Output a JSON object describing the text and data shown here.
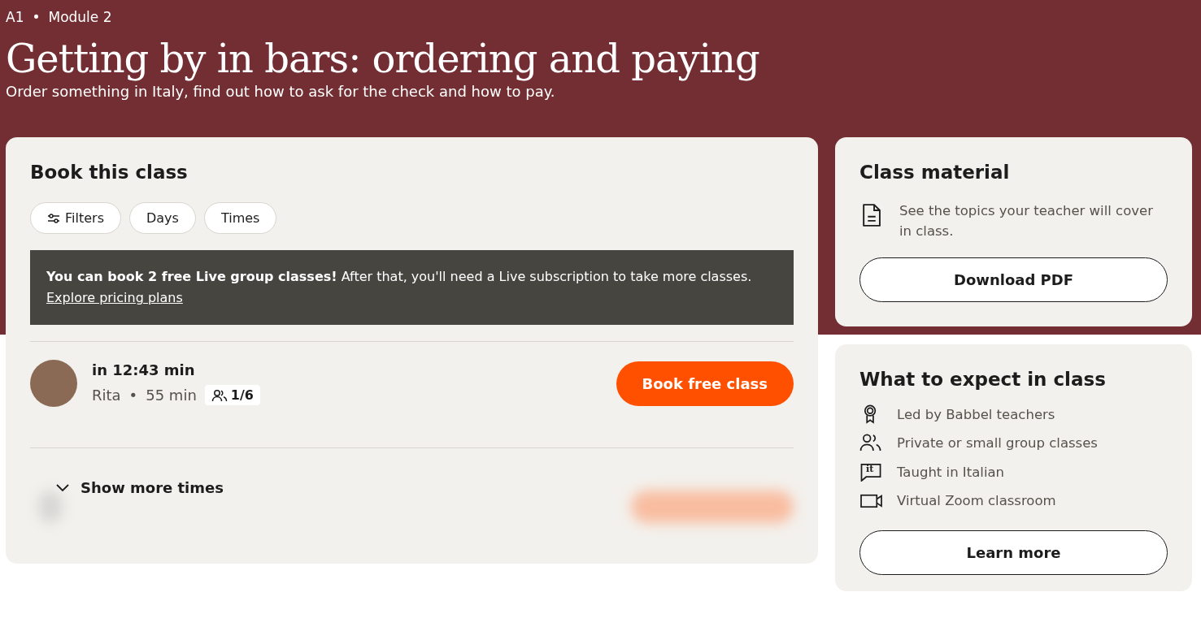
{
  "breadcrumb": {
    "level": "A1",
    "separator": "•",
    "module": "Module 2"
  },
  "title": "Getting by in bars: ordering and paying",
  "subtitle": "Order something in Italy, find out how to ask for the check and how to pay.",
  "booking": {
    "heading": "Book this class",
    "filters": [
      {
        "label": "Filters",
        "kind": "filters"
      },
      {
        "label": "Days",
        "kind": "plain"
      },
      {
        "label": "Times",
        "kind": "plain"
      }
    ],
    "notice": {
      "text": "**You can book 2 free Live group classes!** After that, you'll need a Live subscription to take more classes.",
      "link": "Explore pricing plans"
    },
    "sessions": [
      {
        "start": "in 12:43 min",
        "teacher": "Rita",
        "separator": "•",
        "duration": "55 min",
        "seats": "1/6",
        "button": "Book free class"
      }
    ],
    "show_more": "Show more times"
  },
  "material": {
    "heading": "Class material",
    "text": "See the topics your teacher will cover in class.",
    "button": "Download PDF"
  },
  "expect": {
    "heading": "What to expect in class",
    "items": [
      {
        "text": "Led by Babbel teachers"
      },
      {
        "text": "Private or small group classes"
      },
      {
        "text": "Taught in Italian",
        "icon_text": "it"
      },
      {
        "text": "Virtual Zoom classroom"
      }
    ],
    "button": "Learn more"
  }
}
